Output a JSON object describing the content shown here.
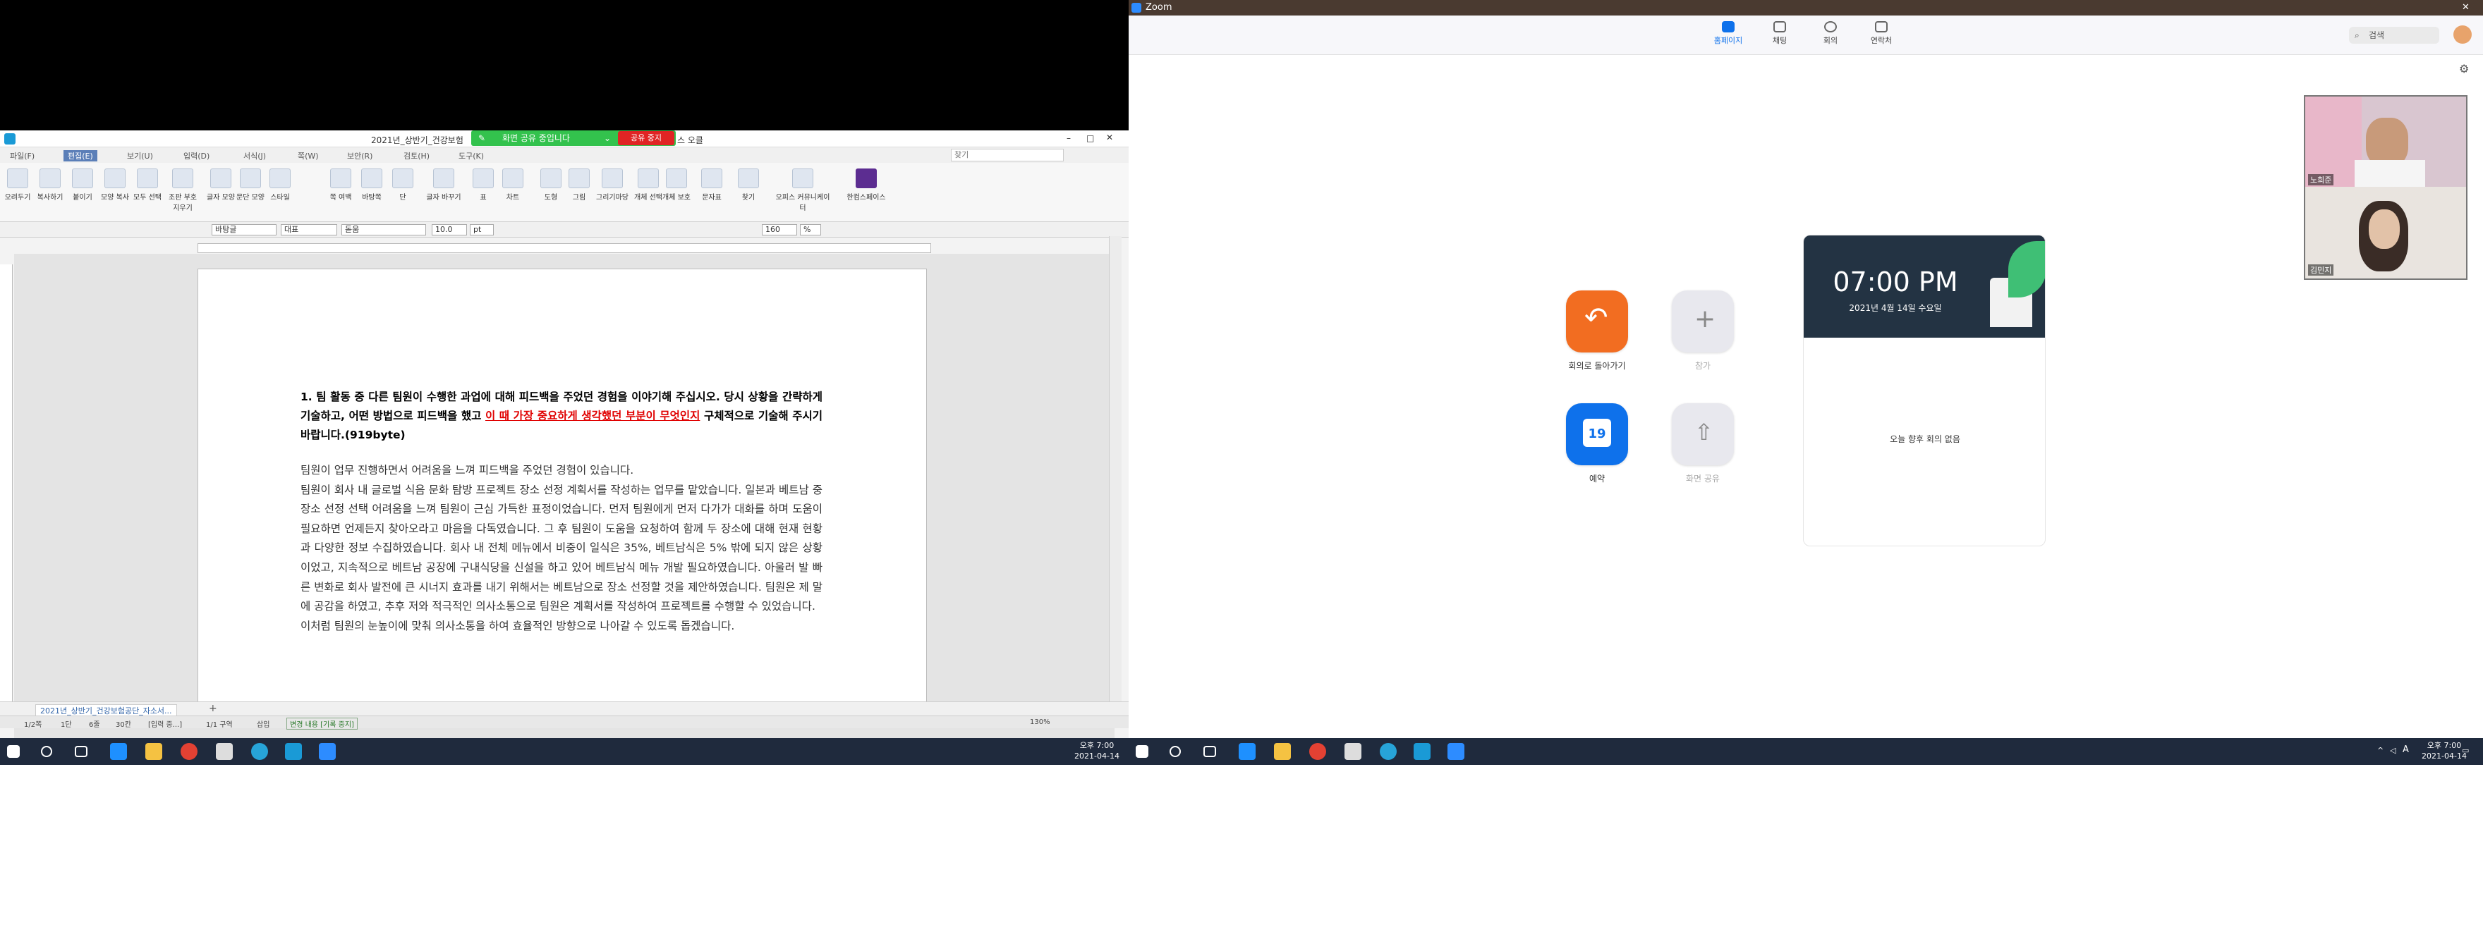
{
  "hwp": {
    "title": "2021년_상반기_건강보험",
    "title_suffix": "스 오클",
    "share_notice": "화면 공유 중입니다",
    "share_stop": "공유 중지",
    "menu": [
      "파일(F)",
      "편집(E)",
      "보기(U)",
      "입력(D)",
      "서식(J)",
      "쪽(W)",
      "보안(R)",
      "검토(H)",
      "도구(K)"
    ],
    "search_placeholder": "찾기",
    "ribbon": [
      "오려두기",
      "복사하기",
      "붙이기",
      "모양 복사",
      "모두 선택",
      "조판 부호 지우기",
      "글자 모양",
      "문단 모양",
      "스타일",
      "쪽 여백",
      "바탕쪽",
      "단",
      "글자 바꾸기",
      "표",
      "차트",
      "도형",
      "그림",
      "그리기마당",
      "개체 선택",
      "개체 보호",
      "문자표",
      "찾기",
      "오피스 커뮤니케이터",
      "한컴스페이스"
    ],
    "format": {
      "style": "바탕글",
      "font_lang": "대표",
      "font": "돋움",
      "size": "10.0",
      "unit": "pt",
      "zoom": "160",
      "percent": "%"
    },
    "question": {
      "part1": "1. 팀 활동 중 다른 팀원이 수행한 과업에 대해 피드백을 주었던 경험을 이야기해 주십시오. 당시 상황을 간략하게 기술하고, 어떤 방법으로 피드백을 했고 ",
      "red": "이 때 가장 중요하게 생각했던 부분이 무엇인지",
      "part2": " 구체적으로 기술해 주시기 바랍니다.(919byte)"
    },
    "answer": [
      "팀원이 업무 진행하면서 어려움을 느껴 피드백을 주었던 경험이 있습니다.",
      "팀원이 회사 내 글로벌 식음 문화 탐방 프로젝트 장소 선정 계획서를 작성하는 업무를 맡았습니다. 일본과 베트남 중 장소 선정 선택 어려움을 느껴 팀원이 근심 가득한 표정이었습니다. 먼저 팀원에게 먼저 다가가 대화를 하며 도움이 필요하면 언제든지 찾아오라고 마음을 다독였습니다. 그 후 팀원이 도움을 요청하여 함께 두 장소에 대해 현재 현황과 다양한 정보 수집하였습니다. 회사 내 전체 메뉴에서 비중이 일식은 35%, 베트남식은 5% 밖에 되지 않은 상황이었고, 지속적으로 베트남 공장에 구내식당을 신설을 하고 있어 베트남식 메뉴 개발 필요하였습니다. 아울러 발 빠른 변화로 회사 발전에 큰 시너지 효과를 내기 위해서는 베트남으로 장소 선정할 것을 제안하였습니다. 팀원은 제 말에 공감을 하였고, 추후 저와 적극적인 의사소통으로 팀원은 계획서를 작성하여 프로젝트를 수행할 수 있었습니다.",
      "이처럼 팀원의 눈높이에 맞춰 의사소통을 하여 효율적인 방향으로 나아갈 수 있도록 돕겠습니다."
    ],
    "doc_tab": "2021년_상반기_건강보험공단_자소서...",
    "status": [
      "1/2쪽",
      "1단",
      "6줄",
      "30칸",
      "[입력 중...]",
      "1/1 구역",
      "삽입",
      "변경 내용 [기록 중지]",
      "130%"
    ]
  },
  "taskbar": {
    "time": "오후 7:00",
    "date": "2021-04-14",
    "ime": "A"
  },
  "zoom": {
    "app_title": "Zoom",
    "nav": [
      "홈페이지",
      "채팅",
      "회의",
      "연락처"
    ],
    "search_placeholder": "검색",
    "actions": {
      "rejoin": "회의로 돌아가기",
      "join": "참가",
      "schedule": "예약",
      "share": "화면 공유",
      "calendar_day": "19"
    },
    "clock_time": "07:00 PM",
    "clock_date": "2021년 4월 14일 수요일",
    "no_meetings": "오늘 향후 회의 없음",
    "video_names": [
      "노희준",
      "김민지"
    ],
    "colors": {
      "orange": "#f26d21",
      "blue": "#0e71eb",
      "grey_btn": "#e8e8ee",
      "card_dark": "#233343"
    }
  }
}
